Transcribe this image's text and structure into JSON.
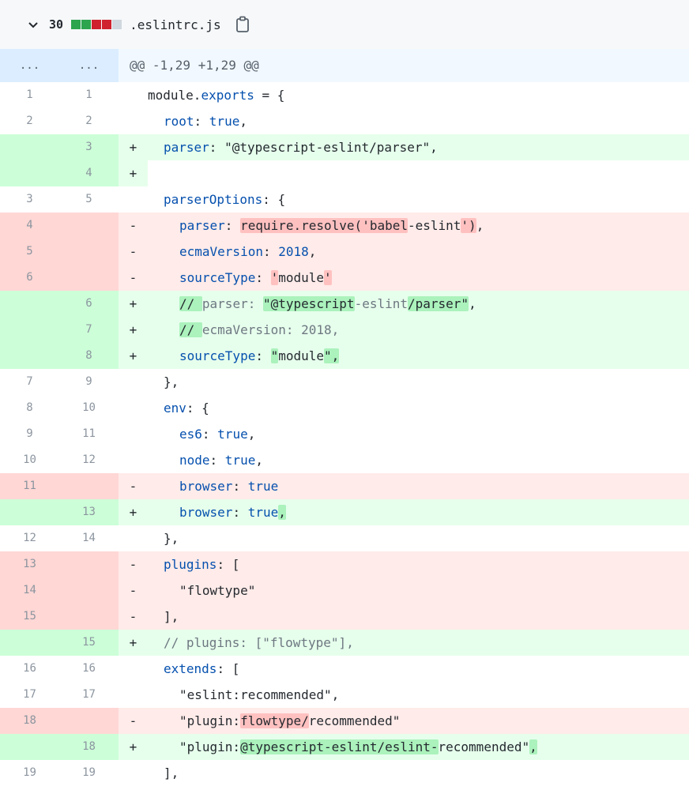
{
  "file": {
    "changes": "30",
    "name": ".eslintrc.js",
    "bar_colors": [
      "#2da44e",
      "#2da44e",
      "#cf222e",
      "#cf222e",
      "#d0d7de"
    ]
  },
  "hunk": {
    "header": "@@ -1,29 +1,29 @@",
    "old_dots": "...",
    "new_dots": "..."
  },
  "lines": [
    {
      "type": "ctx",
      "old": "1",
      "new": "1",
      "parts": [
        [
          "",
          "module."
        ],
        [
          "kw",
          "exports"
        ],
        [
          "",
          " = {"
        ]
      ],
      "indent": 0
    },
    {
      "type": "ctx",
      "old": "2",
      "new": "2",
      "parts": [
        [
          "kw",
          "root"
        ],
        [
          "",
          ": "
        ],
        [
          "kw",
          "true"
        ],
        [
          "",
          ","
        ]
      ],
      "indent": 1
    },
    {
      "type": "add",
      "old": "",
      "new": "3",
      "parts": [
        [
          "kw",
          "parser"
        ],
        [
          "",
          ": \"@typescript-eslint/parser\","
        ]
      ],
      "indent": 1
    },
    {
      "type": "add",
      "old": "",
      "new": "4",
      "parts": [],
      "indent": 0
    },
    {
      "type": "ctx",
      "old": "3",
      "new": "5",
      "parts": [
        [
          "kw",
          "parserOptions"
        ],
        [
          "",
          ": {"
        ]
      ],
      "indent": 1
    },
    {
      "type": "del",
      "old": "4",
      "new": "",
      "parts": [
        [
          "kw",
          "parser"
        ],
        [
          "",
          ": "
        ],
        [
          "hl-d",
          "require.resolve('babel"
        ],
        [
          "",
          "-eslint"
        ],
        [
          "hl-d",
          "')"
        ],
        [
          "",
          ","
        ]
      ],
      "indent": 2
    },
    {
      "type": "del",
      "old": "5",
      "new": "",
      "parts": [
        [
          "kw",
          "ecmaVersion"
        ],
        [
          "",
          ": "
        ],
        [
          "kw",
          "2018"
        ],
        [
          "",
          ","
        ]
      ],
      "indent": 2
    },
    {
      "type": "del",
      "old": "6",
      "new": "",
      "parts": [
        [
          "kw",
          "sourceType"
        ],
        [
          "",
          ": "
        ],
        [
          "hl-d",
          "'"
        ],
        [
          "",
          "module"
        ],
        [
          "hl-d",
          "'"
        ]
      ],
      "indent": 2
    },
    {
      "type": "add",
      "old": "",
      "new": "6",
      "parts": [
        [
          "hl-a",
          "// "
        ],
        [
          "cm",
          "parser: "
        ],
        [
          "hl-a",
          "\"@typescript"
        ],
        [
          "cm",
          "-eslint"
        ],
        [
          "hl-a",
          "/parser\""
        ],
        [
          "",
          ","
        ]
      ],
      "indent": 2
    },
    {
      "type": "add",
      "old": "",
      "new": "7",
      "parts": [
        [
          "hl-a",
          "// "
        ],
        [
          "cm",
          "ecmaVersion: 2018,"
        ]
      ],
      "indent": 2
    },
    {
      "type": "add",
      "old": "",
      "new": "8",
      "parts": [
        [
          "kw",
          "sourceType"
        ],
        [
          "",
          ": "
        ],
        [
          "hl-a",
          "\""
        ],
        [
          "",
          "module"
        ],
        [
          "hl-a",
          "\","
        ]
      ],
      "indent": 2
    },
    {
      "type": "ctx",
      "old": "7",
      "new": "9",
      "parts": [
        [
          "",
          "},"
        ]
      ],
      "indent": 1
    },
    {
      "type": "ctx",
      "old": "8",
      "new": "10",
      "parts": [
        [
          "kw",
          "env"
        ],
        [
          "",
          ": {"
        ]
      ],
      "indent": 1
    },
    {
      "type": "ctx",
      "old": "9",
      "new": "11",
      "parts": [
        [
          "kw",
          "es6"
        ],
        [
          "",
          ": "
        ],
        [
          "kw",
          "true"
        ],
        [
          "",
          ","
        ]
      ],
      "indent": 2
    },
    {
      "type": "ctx",
      "old": "10",
      "new": "12",
      "parts": [
        [
          "kw",
          "node"
        ],
        [
          "",
          ": "
        ],
        [
          "kw",
          "true"
        ],
        [
          "",
          ","
        ]
      ],
      "indent": 2
    },
    {
      "type": "del",
      "old": "11",
      "new": "",
      "parts": [
        [
          "kw",
          "browser"
        ],
        [
          "",
          ": "
        ],
        [
          "kw",
          "true"
        ]
      ],
      "indent": 2
    },
    {
      "type": "add",
      "old": "",
      "new": "13",
      "parts": [
        [
          "kw",
          "browser"
        ],
        [
          "",
          ": "
        ],
        [
          "kw",
          "true"
        ],
        [
          "hl-a",
          ","
        ]
      ],
      "indent": 2
    },
    {
      "type": "ctx",
      "old": "12",
      "new": "14",
      "parts": [
        [
          "",
          "},"
        ]
      ],
      "indent": 1
    },
    {
      "type": "del",
      "old": "13",
      "new": "",
      "parts": [
        [
          "kw",
          "plugins"
        ],
        [
          "",
          ": ["
        ]
      ],
      "indent": 1
    },
    {
      "type": "del",
      "old": "14",
      "new": "",
      "parts": [
        [
          "",
          "\"flowtype\""
        ]
      ],
      "indent": 2
    },
    {
      "type": "del",
      "old": "15",
      "new": "",
      "parts": [
        [
          "",
          "],"
        ]
      ],
      "indent": 1
    },
    {
      "type": "add",
      "old": "",
      "new": "15",
      "parts": [
        [
          "cm",
          "// plugins: [\"flowtype\"],"
        ]
      ],
      "indent": 1
    },
    {
      "type": "ctx",
      "old": "16",
      "new": "16",
      "parts": [
        [
          "kw",
          "extends"
        ],
        [
          "",
          ": ["
        ]
      ],
      "indent": 1
    },
    {
      "type": "ctx",
      "old": "17",
      "new": "17",
      "parts": [
        [
          "",
          "\"eslint:recommended\","
        ]
      ],
      "indent": 2
    },
    {
      "type": "del",
      "old": "18",
      "new": "",
      "parts": [
        [
          "",
          "\"plugin:"
        ],
        [
          "hl-d",
          "flowtype/"
        ],
        [
          "",
          "recommended\""
        ]
      ],
      "indent": 2
    },
    {
      "type": "add",
      "old": "",
      "new": "18",
      "parts": [
        [
          "",
          "\"plugin:"
        ],
        [
          "hl-a",
          "@typescript-eslint/eslint-"
        ],
        [
          "",
          "recommended\""
        ],
        [
          "hl-a",
          ","
        ]
      ],
      "indent": 2
    },
    {
      "type": "ctx",
      "old": "19",
      "new": "19",
      "parts": [
        [
          "",
          "],"
        ]
      ],
      "indent": 1
    }
  ],
  "signs": {
    "add": "+",
    "del": "-",
    "ctx": " "
  }
}
